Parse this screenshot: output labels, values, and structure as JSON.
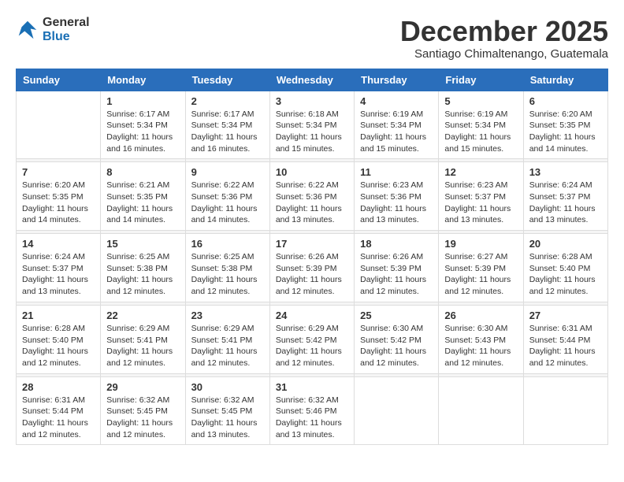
{
  "header": {
    "logo_line1": "General",
    "logo_line2": "Blue",
    "month": "December 2025",
    "location": "Santiago Chimaltenango, Guatemala"
  },
  "weekdays": [
    "Sunday",
    "Monday",
    "Tuesday",
    "Wednesday",
    "Thursday",
    "Friday",
    "Saturday"
  ],
  "weeks": [
    [
      {
        "day": "",
        "sunrise": "",
        "sunset": "",
        "daylight": ""
      },
      {
        "day": "1",
        "sunrise": "Sunrise: 6:17 AM",
        "sunset": "Sunset: 5:34 PM",
        "daylight": "Daylight: 11 hours and 16 minutes."
      },
      {
        "day": "2",
        "sunrise": "Sunrise: 6:17 AM",
        "sunset": "Sunset: 5:34 PM",
        "daylight": "Daylight: 11 hours and 16 minutes."
      },
      {
        "day": "3",
        "sunrise": "Sunrise: 6:18 AM",
        "sunset": "Sunset: 5:34 PM",
        "daylight": "Daylight: 11 hours and 15 minutes."
      },
      {
        "day": "4",
        "sunrise": "Sunrise: 6:19 AM",
        "sunset": "Sunset: 5:34 PM",
        "daylight": "Daylight: 11 hours and 15 minutes."
      },
      {
        "day": "5",
        "sunrise": "Sunrise: 6:19 AM",
        "sunset": "Sunset: 5:34 PM",
        "daylight": "Daylight: 11 hours and 15 minutes."
      },
      {
        "day": "6",
        "sunrise": "Sunrise: 6:20 AM",
        "sunset": "Sunset: 5:35 PM",
        "daylight": "Daylight: 11 hours and 14 minutes."
      }
    ],
    [
      {
        "day": "7",
        "sunrise": "Sunrise: 6:20 AM",
        "sunset": "Sunset: 5:35 PM",
        "daylight": "Daylight: 11 hours and 14 minutes."
      },
      {
        "day": "8",
        "sunrise": "Sunrise: 6:21 AM",
        "sunset": "Sunset: 5:35 PM",
        "daylight": "Daylight: 11 hours and 14 minutes."
      },
      {
        "day": "9",
        "sunrise": "Sunrise: 6:22 AM",
        "sunset": "Sunset: 5:36 PM",
        "daylight": "Daylight: 11 hours and 14 minutes."
      },
      {
        "day": "10",
        "sunrise": "Sunrise: 6:22 AM",
        "sunset": "Sunset: 5:36 PM",
        "daylight": "Daylight: 11 hours and 13 minutes."
      },
      {
        "day": "11",
        "sunrise": "Sunrise: 6:23 AM",
        "sunset": "Sunset: 5:36 PM",
        "daylight": "Daylight: 11 hours and 13 minutes."
      },
      {
        "day": "12",
        "sunrise": "Sunrise: 6:23 AM",
        "sunset": "Sunset: 5:37 PM",
        "daylight": "Daylight: 11 hours and 13 minutes."
      },
      {
        "day": "13",
        "sunrise": "Sunrise: 6:24 AM",
        "sunset": "Sunset: 5:37 PM",
        "daylight": "Daylight: 11 hours and 13 minutes."
      }
    ],
    [
      {
        "day": "14",
        "sunrise": "Sunrise: 6:24 AM",
        "sunset": "Sunset: 5:37 PM",
        "daylight": "Daylight: 11 hours and 13 minutes."
      },
      {
        "day": "15",
        "sunrise": "Sunrise: 6:25 AM",
        "sunset": "Sunset: 5:38 PM",
        "daylight": "Daylight: 11 hours and 12 minutes."
      },
      {
        "day": "16",
        "sunrise": "Sunrise: 6:25 AM",
        "sunset": "Sunset: 5:38 PM",
        "daylight": "Daylight: 11 hours and 12 minutes."
      },
      {
        "day": "17",
        "sunrise": "Sunrise: 6:26 AM",
        "sunset": "Sunset: 5:39 PM",
        "daylight": "Daylight: 11 hours and 12 minutes."
      },
      {
        "day": "18",
        "sunrise": "Sunrise: 6:26 AM",
        "sunset": "Sunset: 5:39 PM",
        "daylight": "Daylight: 11 hours and 12 minutes."
      },
      {
        "day": "19",
        "sunrise": "Sunrise: 6:27 AM",
        "sunset": "Sunset: 5:39 PM",
        "daylight": "Daylight: 11 hours and 12 minutes."
      },
      {
        "day": "20",
        "sunrise": "Sunrise: 6:28 AM",
        "sunset": "Sunset: 5:40 PM",
        "daylight": "Daylight: 11 hours and 12 minutes."
      }
    ],
    [
      {
        "day": "21",
        "sunrise": "Sunrise: 6:28 AM",
        "sunset": "Sunset: 5:40 PM",
        "daylight": "Daylight: 11 hours and 12 minutes."
      },
      {
        "day": "22",
        "sunrise": "Sunrise: 6:29 AM",
        "sunset": "Sunset: 5:41 PM",
        "daylight": "Daylight: 11 hours and 12 minutes."
      },
      {
        "day": "23",
        "sunrise": "Sunrise: 6:29 AM",
        "sunset": "Sunset: 5:41 PM",
        "daylight": "Daylight: 11 hours and 12 minutes."
      },
      {
        "day": "24",
        "sunrise": "Sunrise: 6:29 AM",
        "sunset": "Sunset: 5:42 PM",
        "daylight": "Daylight: 11 hours and 12 minutes."
      },
      {
        "day": "25",
        "sunrise": "Sunrise: 6:30 AM",
        "sunset": "Sunset: 5:42 PM",
        "daylight": "Daylight: 11 hours and 12 minutes."
      },
      {
        "day": "26",
        "sunrise": "Sunrise: 6:30 AM",
        "sunset": "Sunset: 5:43 PM",
        "daylight": "Daylight: 11 hours and 12 minutes."
      },
      {
        "day": "27",
        "sunrise": "Sunrise: 6:31 AM",
        "sunset": "Sunset: 5:44 PM",
        "daylight": "Daylight: 11 hours and 12 minutes."
      }
    ],
    [
      {
        "day": "28",
        "sunrise": "Sunrise: 6:31 AM",
        "sunset": "Sunset: 5:44 PM",
        "daylight": "Daylight: 11 hours and 12 minutes."
      },
      {
        "day": "29",
        "sunrise": "Sunrise: 6:32 AM",
        "sunset": "Sunset: 5:45 PM",
        "daylight": "Daylight: 11 hours and 12 minutes."
      },
      {
        "day": "30",
        "sunrise": "Sunrise: 6:32 AM",
        "sunset": "Sunset: 5:45 PM",
        "daylight": "Daylight: 11 hours and 13 minutes."
      },
      {
        "day": "31",
        "sunrise": "Sunrise: 6:32 AM",
        "sunset": "Sunset: 5:46 PM",
        "daylight": "Daylight: 11 hours and 13 minutes."
      },
      {
        "day": "",
        "sunrise": "",
        "sunset": "",
        "daylight": ""
      },
      {
        "day": "",
        "sunrise": "",
        "sunset": "",
        "daylight": ""
      },
      {
        "day": "",
        "sunrise": "",
        "sunset": "",
        "daylight": ""
      }
    ]
  ]
}
